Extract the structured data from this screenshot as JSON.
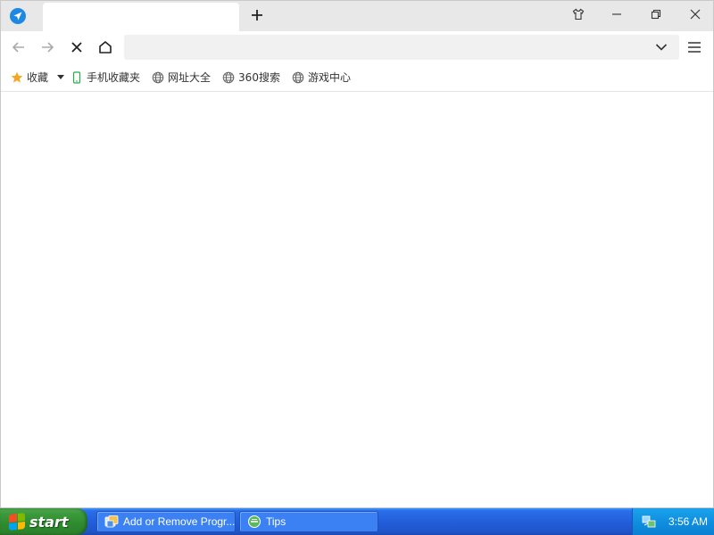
{
  "browser": {
    "tab": {
      "title": ""
    },
    "address_bar": {
      "value": "",
      "placeholder": ""
    },
    "bookmarks": [
      {
        "label": "收藏",
        "icon": "star-icon"
      },
      {
        "label": "手机收藏夹",
        "icon": "phone-icon"
      },
      {
        "label": "网址大全",
        "icon": "globe-icon"
      },
      {
        "label": "360搜索",
        "icon": "globe-icon"
      },
      {
        "label": "游戏中心",
        "icon": "globe-icon"
      }
    ]
  },
  "taskbar": {
    "start_label": "start",
    "tasks": [
      {
        "label": "Add or Remove Progr...",
        "icon": "control-panel-icon"
      },
      {
        "label": "Tips",
        "icon": "browser-icon"
      }
    ],
    "clock": "3:56 AM"
  },
  "colors": {
    "accent": "#1e88e5",
    "star": "#f5a623",
    "taskbar_blue": "#245edb",
    "start_green": "#3c9a3c"
  }
}
